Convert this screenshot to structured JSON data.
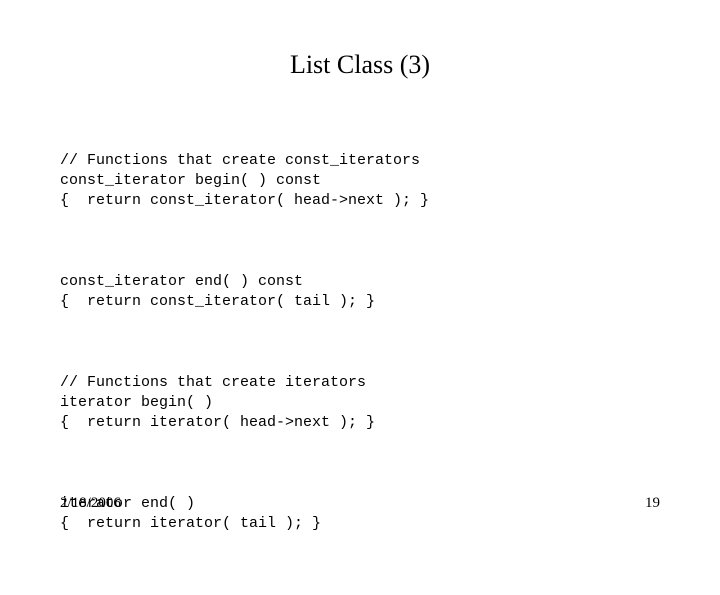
{
  "title": "List Class (3)",
  "code": {
    "section1_line1": "// Functions that create const_iterators",
    "section1_line2": "const_iterator begin( ) const",
    "section1_line3": "{  return const_iterator( head->next ); }",
    "section2_line1": "const_iterator end( ) const",
    "section2_line2": "{  return const_iterator( tail ); }",
    "section3_line1": "// Functions that create iterators",
    "section3_line2": "iterator begin( )",
    "section3_line3": "{  return iterator( head->next ); }",
    "section4_line1": "iterator end( )",
    "section4_line2": "{  return iterator( tail ); }"
  },
  "footer": {
    "date": "2/18/2006",
    "page": "19"
  }
}
